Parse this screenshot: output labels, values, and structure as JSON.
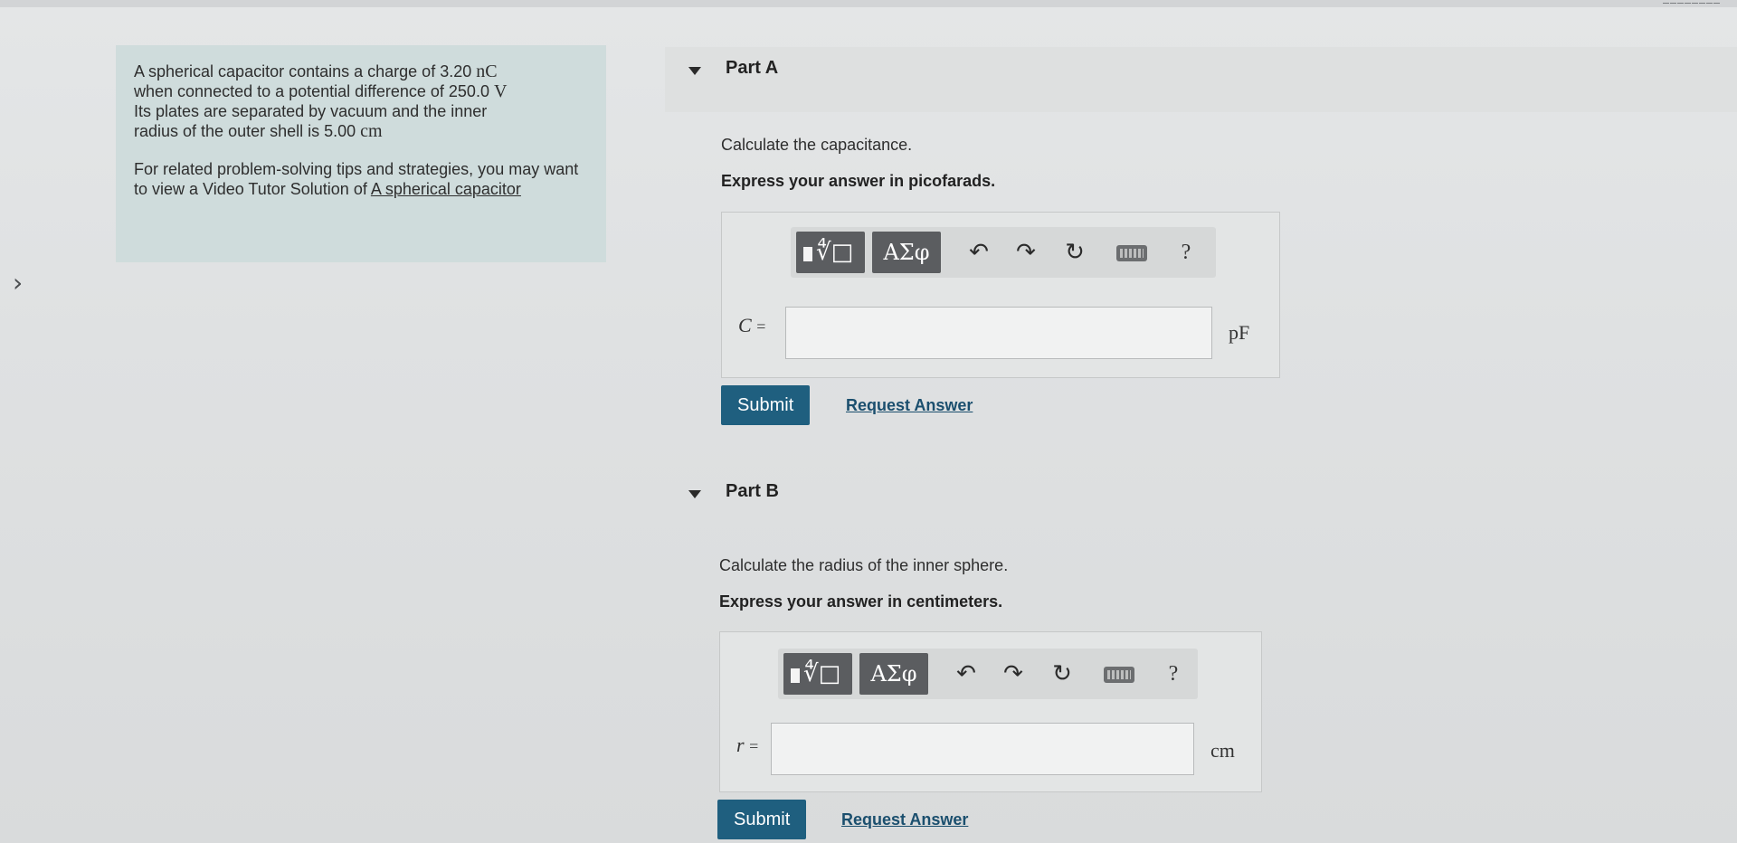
{
  "intro": {
    "line1_pre": "A spherical capacitor contains a charge of 3.20 ",
    "line1_unit": "nC",
    "line2_pre": "when connected to a potential difference of 250.0 ",
    "line2_unit": "V",
    "line3": "Its plates are separated by vacuum and the inner",
    "line4_pre": "radius of the outer shell is 5.00 ",
    "line4_unit": "cm",
    "tips_pre": "For related problem-solving tips and strategies, you may want to view a Video Tutor Solution of ",
    "tips_link": "A spherical capacitor"
  },
  "parts": [
    {
      "title": "Part A",
      "question": "Calculate the capacitance.",
      "instruction": "Express your answer in picofarads.",
      "variable": "C",
      "equals": "=",
      "value": "",
      "unit": "pF",
      "submit_label": "Submit",
      "request_label": "Request Answer"
    },
    {
      "title": "Part B",
      "question": "Calculate the radius of the inner sphere.",
      "instruction": "Express your answer in centimeters.",
      "variable": "r",
      "equals": "=",
      "value": "",
      "unit": "cm",
      "submit_label": "Submit",
      "request_label": "Request Answer"
    }
  ],
  "toolbar": {
    "template_icon": "radical-template-icon",
    "greek_label": "ΑΣφ",
    "undo_icon": "undo-icon",
    "redo_icon": "redo-icon",
    "reset_icon": "reset-icon",
    "keyboard_icon": "keyboard-icon",
    "help_label": "?"
  },
  "colors": {
    "intro_bg": "#cfdcdc",
    "submit_bg": "#1f5f7f",
    "link": "#1b4f6e",
    "toolbar_button": "#5b5d60"
  }
}
